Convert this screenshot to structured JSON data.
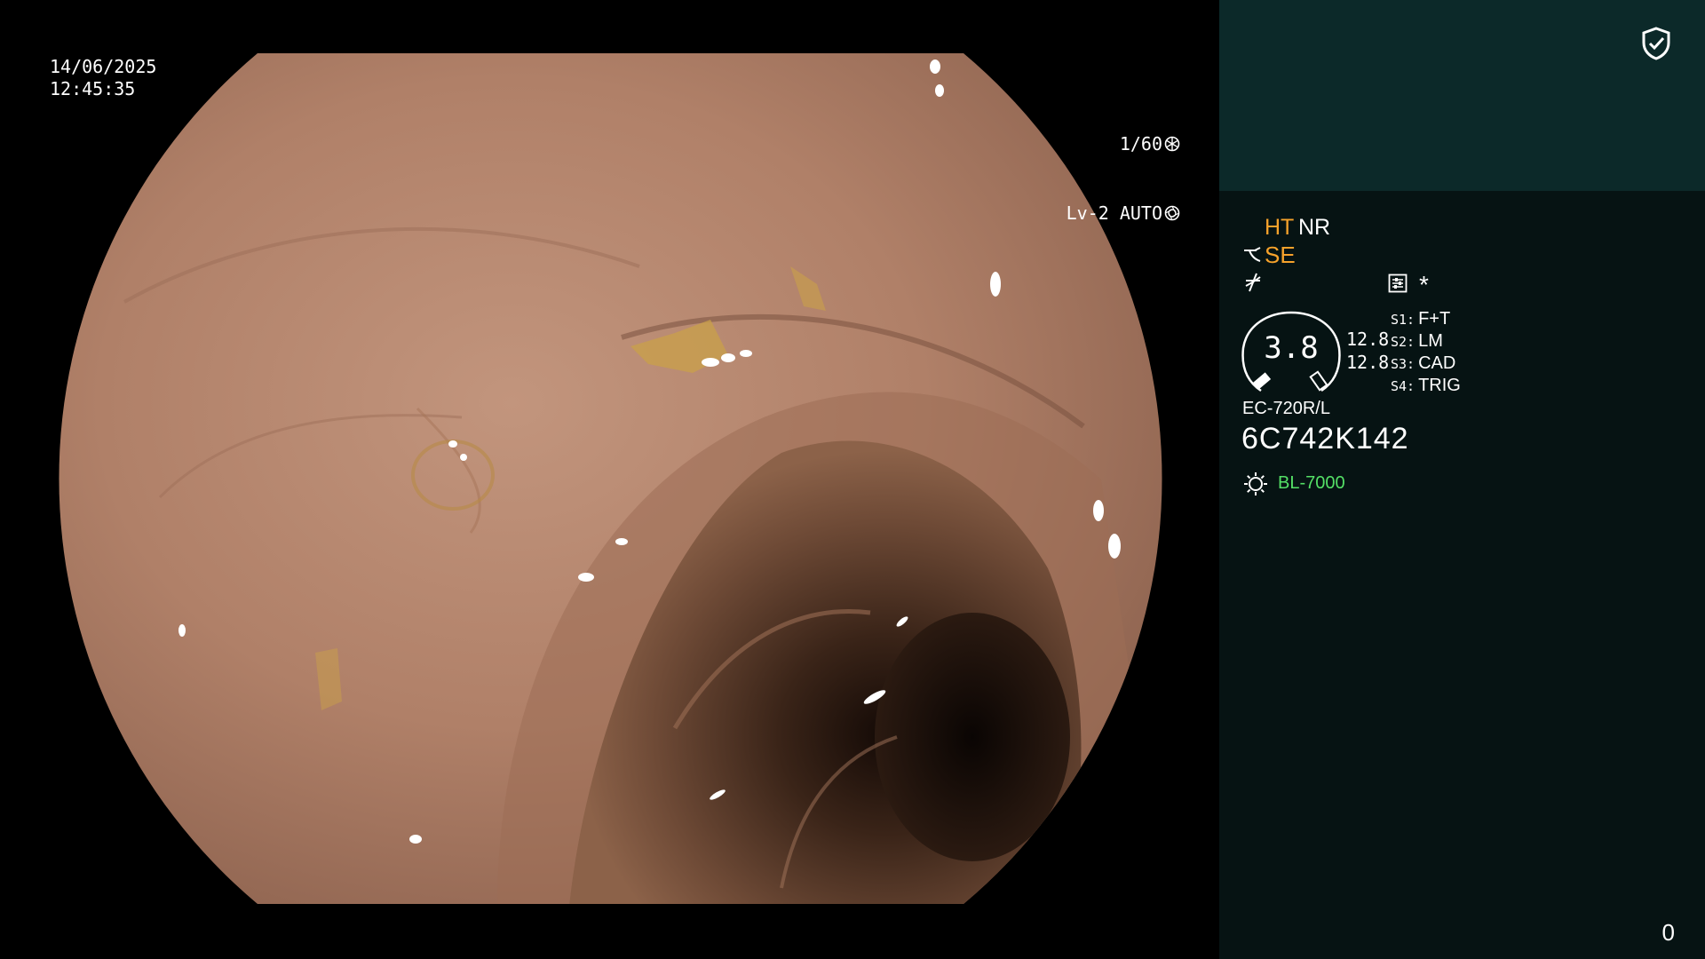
{
  "overlay": {
    "date": "14/06/2025",
    "time": "12:45:35",
    "shutter": "1/60",
    "exposure_mode": "Lv-2 AUTO"
  },
  "panel": {
    "ht_label": "HT",
    "nr_label": "NR",
    "se_label": "SE",
    "gauge_value": "3.8",
    "side_value_1": "12.8",
    "side_value_2": "12.8",
    "switches": [
      {
        "key": "S1:",
        "value": "F+T"
      },
      {
        "key": "S2:",
        "value": "LM"
      },
      {
        "key": "S3:",
        "value": "CAD"
      },
      {
        "key": "S4:",
        "value": "TRIG"
      }
    ],
    "scope_model": "EC-720R/L",
    "scope_serial": "6C742K142",
    "light_source": "BL-7000",
    "image_counter": "0",
    "star": "*"
  },
  "icons": {
    "shield": "shield-check-icon",
    "shutter": "aperture-icon",
    "auto": "iris-icon",
    "se": "structure-enhance-icon",
    "ne": "not-equal-icon",
    "settings": "settings-icon",
    "light": "sun-icon"
  },
  "colors": {
    "panel_top": "#0c2929",
    "panel_bottom": "#061313",
    "orange_label": "#f6a22b",
    "green_label": "#54e066"
  }
}
